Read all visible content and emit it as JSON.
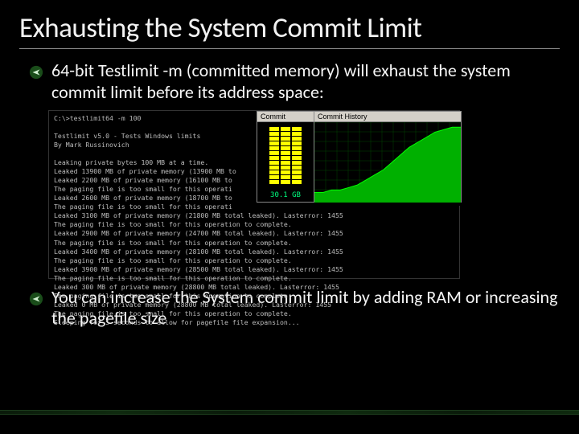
{
  "title": "Exhausting the System Commit Limit",
  "bullets": [
    "64-bit Testlimit -m (committed memory) will exhaust the system commit limit before its address space:",
    "You can increase the System commit limit by adding RAM or increasing the pagefile size"
  ],
  "terminal": {
    "prompt": "C:\\>testlimit64 -m 100",
    "header1": "Testlimit v5.0 - Tests Windows limits",
    "header2": "By Mark Russinovich",
    "lines": [
      "Leaking private bytes 100 MB at a time.",
      "Leaked 13900 MB of private memory (13900 MB to",
      "Leaked 2200 MB of private memory (16100 MB to",
      "The paging file is too small for this operati",
      "Leaked 2600 MB of private memory (18700 MB to",
      "The paging file is too small for this operati",
      "Leaked 3100 MB of private memory (21800 MB total leaked). Lasterror: 1455",
      "The paging file is too small for this operation to complete.",
      "Leaked 2900 MB of private memory (24700 MB total leaked). Lasterror: 1455",
      "The paging file is too small for this operation to complete.",
      "Leaked 3400 MB of private memory (28100 MB total leaked). Lasterror: 1455",
      "The paging file is too small for this operation to complete.",
      "Leaked 3900 MB of private memory (28500 MB total leaked). Lasterror: 1455",
      "The paging file is too small for this operation to complete.",
      "Leaked 300 MB of private memory (28800 MB total leaked). Lasterror: 1455",
      "The paging file is too small for this operation to complete.",
      "Leaked 0 MB of private memory (28800 MB total leaked). Lasterror: 1455",
      "The paging file is too small for this operation to complete.",
      "Sleeping for 5 seconds to allow for pagefile file expansion..."
    ]
  },
  "panels": {
    "commit": {
      "title": "Commit",
      "value": "30.1 GB"
    },
    "history": {
      "title": "Commit History"
    }
  },
  "chart_data": {
    "type": "area",
    "title": "Commit History",
    "xlabel": "",
    "ylabel": "",
    "ylim": [
      0,
      32
    ],
    "x": [
      0,
      1,
      2,
      3,
      4,
      5,
      6,
      7,
      8,
      9,
      10,
      11,
      12,
      13,
      14,
      15,
      16,
      17
    ],
    "values": [
      4,
      4,
      5,
      5,
      6,
      7,
      9,
      11,
      13,
      16,
      19,
      22,
      24,
      26,
      28,
      29,
      30,
      30
    ]
  }
}
